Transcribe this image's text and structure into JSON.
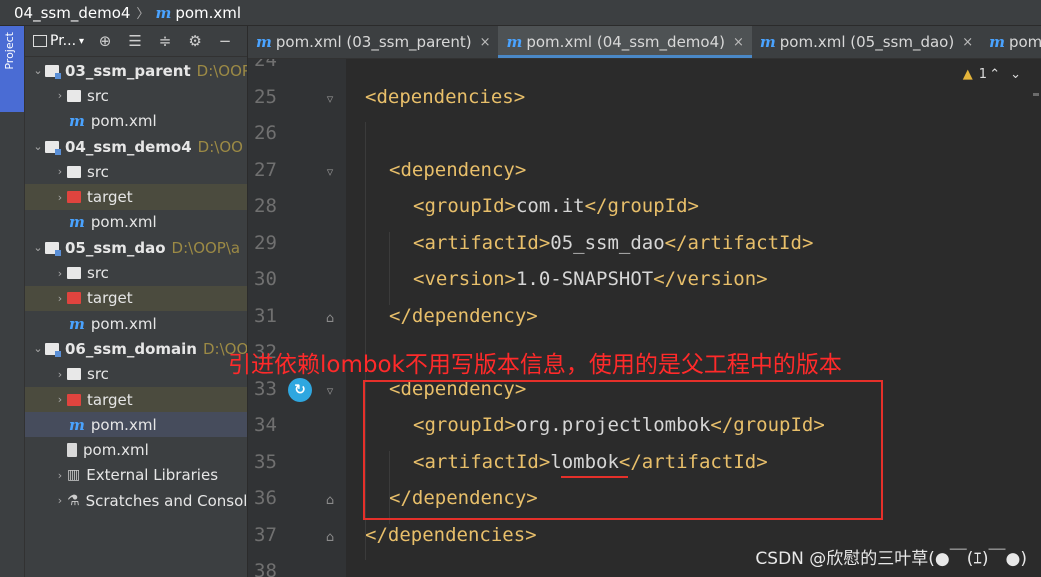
{
  "breadcrumb": {
    "project": "04_ssm_demo4",
    "file": "pom.xml"
  },
  "side_stripe": {
    "label": "Project"
  },
  "project_panel": {
    "view_label": "Pr...",
    "tree": [
      {
        "arrow": "⌄",
        "icon": "module",
        "name": "03_ssm_parent",
        "path": "D:\\OOP",
        "bold": true
      },
      {
        "arrow": "›",
        "icon": "folder",
        "name": "src"
      },
      {
        "arrow": "",
        "icon": "maven",
        "name": "pom.xml"
      },
      {
        "arrow": "⌄",
        "icon": "module",
        "name": "04_ssm_demo4",
        "path": "D:\\OO",
        "bold": true
      },
      {
        "arrow": "›",
        "icon": "folder",
        "name": "src"
      },
      {
        "arrow": "›",
        "icon": "target",
        "name": "target",
        "highlight": "sel"
      },
      {
        "arrow": "",
        "icon": "maven",
        "name": "pom.xml"
      },
      {
        "arrow": "⌄",
        "icon": "module",
        "name": "05_ssm_dao",
        "path": "D:\\OOP\\a",
        "bold": true
      },
      {
        "arrow": "›",
        "icon": "folder",
        "name": "src"
      },
      {
        "arrow": "›",
        "icon": "target",
        "name": "target",
        "highlight": "sel"
      },
      {
        "arrow": "",
        "icon": "maven",
        "name": "pom.xml"
      },
      {
        "arrow": "⌄",
        "icon": "module",
        "name": "06_ssm_domain",
        "path": "D:\\OO",
        "bold": true
      },
      {
        "arrow": "›",
        "icon": "folder",
        "name": "src"
      },
      {
        "arrow": "›",
        "icon": "target",
        "name": "target",
        "highlight": "sel"
      },
      {
        "arrow": "",
        "icon": "maven",
        "name": "pom.xml",
        "highlight": "cur"
      },
      {
        "arrow": "",
        "icon": "xml",
        "name": "pom.xml",
        "indent": 0
      },
      {
        "arrow": "›",
        "icon": "libraries",
        "name": "External Libraries",
        "indent": 0
      },
      {
        "arrow": "›",
        "icon": "scratches",
        "name": "Scratches and Consoles",
        "indent": 0
      }
    ]
  },
  "tabs": [
    {
      "label": "pom.xml (03_ssm_parent)",
      "close": "×"
    },
    {
      "label": "pom.xml (04_ssm_demo4)",
      "close": "×",
      "active": true
    },
    {
      "label": "pom.xml (05_ssm_dao)",
      "close": "×"
    },
    {
      "label": "pom.xml",
      "close": ""
    }
  ],
  "editor": {
    "warning_count": "1",
    "lines": [
      {
        "n": "24",
        "code": ""
      },
      {
        "n": "25",
        "code": "<dependencies>",
        "indent": 0,
        "fold": true
      },
      {
        "n": "26",
        "code": ""
      },
      {
        "n": "27",
        "code": "<dependency>",
        "indent": 1,
        "fold": true
      },
      {
        "n": "28",
        "parts": [
          "<groupId>",
          "com.it",
          "</groupId>"
        ],
        "indent": 2
      },
      {
        "n": "29",
        "parts": [
          "<artifactId>",
          "05_ssm_dao",
          "</artifactId>"
        ],
        "indent": 2
      },
      {
        "n": "30",
        "parts": [
          "<version>",
          "1.0-SNAPSHOT",
          "</version>"
        ],
        "indent": 2
      },
      {
        "n": "31",
        "code": "</dependency>",
        "indent": 1,
        "fold": true
      },
      {
        "n": "32",
        "code": ""
      },
      {
        "n": "33",
        "code": "<dependency>",
        "indent": 1,
        "fold": true
      },
      {
        "n": "34",
        "parts": [
          "<groupId>",
          "org.projectlombok",
          "</groupId>"
        ],
        "indent": 2
      },
      {
        "n": "35",
        "parts": [
          "<artifactId>",
          "lombok",
          "</artifactId>"
        ],
        "indent": 2
      },
      {
        "n": "36",
        "code": "</dependency>",
        "indent": 1,
        "fold": true
      },
      {
        "n": "37",
        "code": "</dependencies>",
        "indent": 0,
        "fold": true
      },
      {
        "n": "38",
        "code": ""
      }
    ]
  },
  "annotation": {
    "text": "引进依赖lombok不用写版本信息，使用的是父工程中的版本"
  },
  "watermark": {
    "text": "CSDN @欣慰的三叶草(●￣(ｴ)￣●)"
  },
  "colors": {
    "accent": "#4a88c7",
    "annotation_red": "#ff2a2a",
    "tag": "#e8bf6a"
  }
}
